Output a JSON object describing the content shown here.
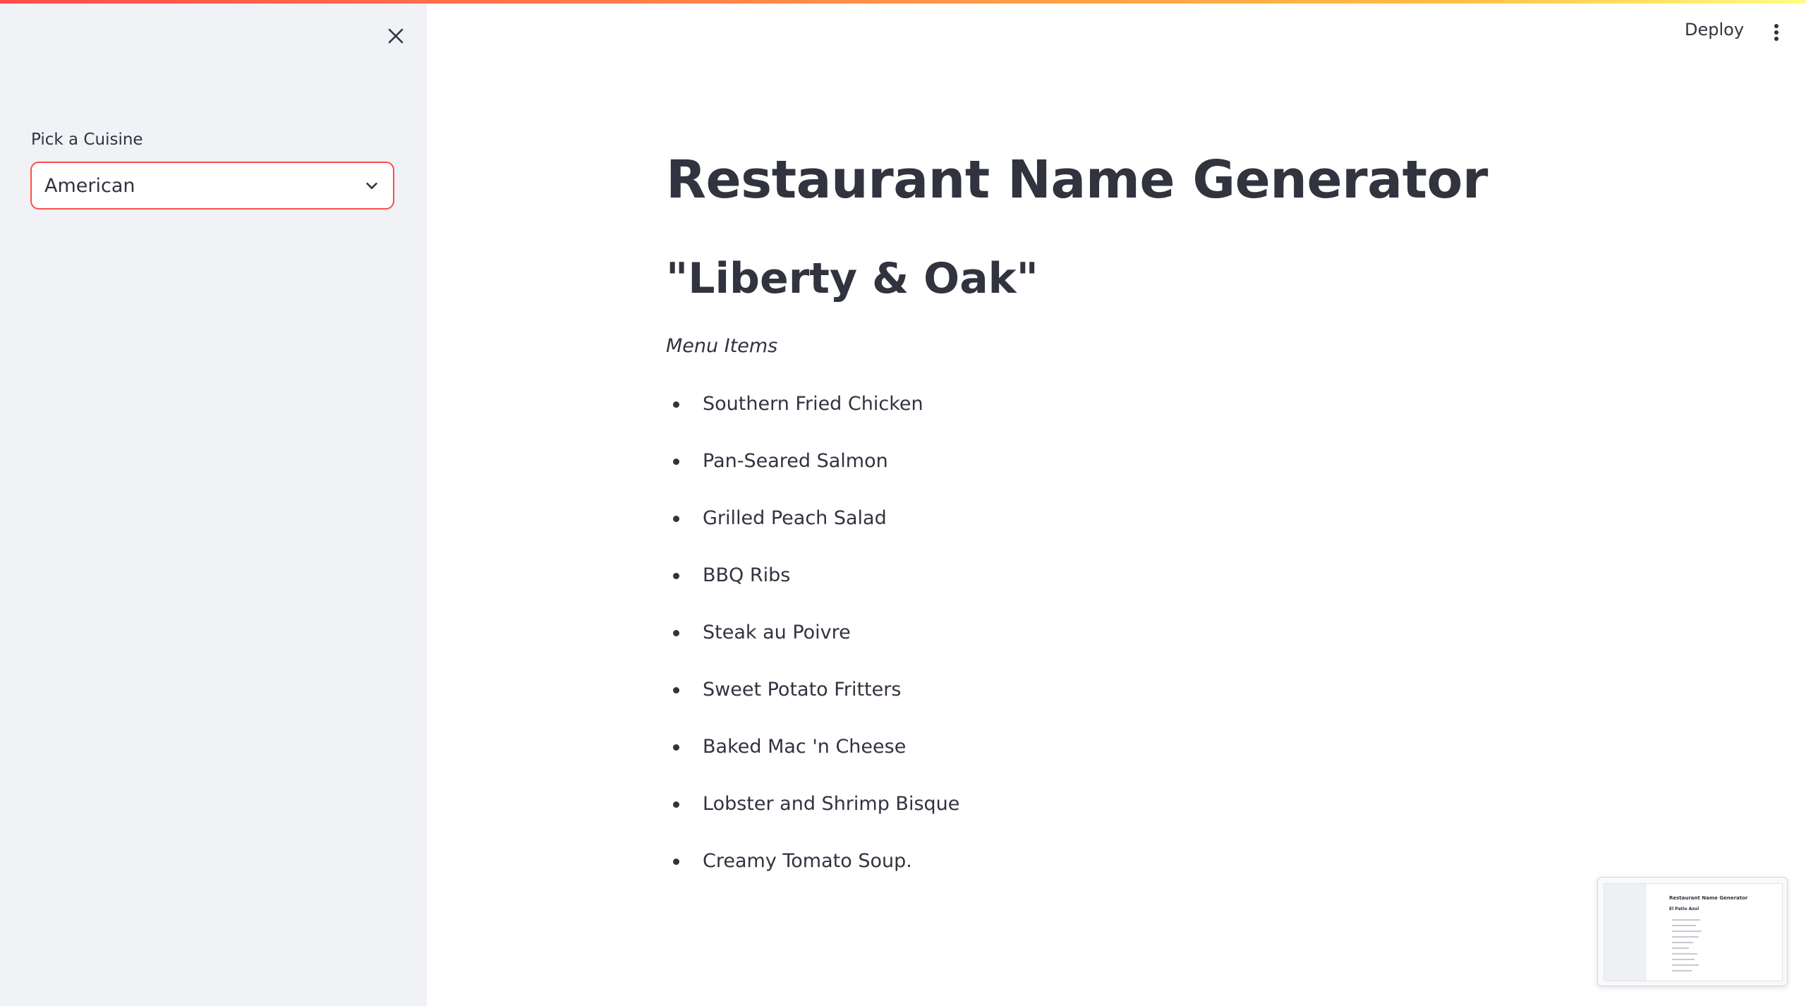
{
  "header": {
    "deploy_label": "Deploy"
  },
  "sidebar": {
    "select_label": "Pick a Cuisine",
    "select_value": "American"
  },
  "main": {
    "title": "Restaurant Name Generator",
    "restaurant_name": "\"Liberty & Oak\"",
    "menu_heading": "Menu Items",
    "menu_items": [
      "Southern Fried Chicken",
      "Pan-Seared Salmon",
      "Grilled Peach Salad",
      "BBQ Ribs",
      "Steak au Poivre",
      "Sweet Potato Fritters",
      "Baked Mac 'n Cheese",
      "Lobster and Shrimp Bisque",
      "Creamy Tomato Soup."
    ]
  },
  "preview": {
    "title": "Restaurant Name Generator",
    "subtitle": "El Patio Azul"
  },
  "colors": {
    "accent": "#ff4b4b",
    "text": "#31333f",
    "sidebar_bg": "#f0f2f6"
  },
  "icons": {
    "close": "close-icon",
    "chevron": "chevron-down-icon",
    "menu": "kebab-menu-icon"
  }
}
